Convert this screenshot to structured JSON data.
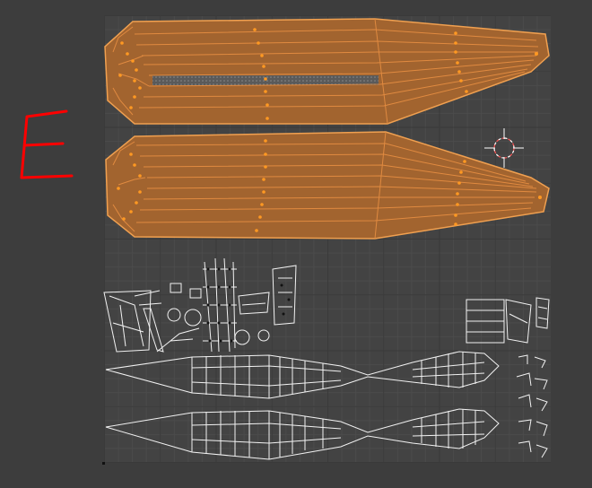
{
  "editor": {
    "type": "uv-image-editor",
    "annotation_letter": "E",
    "colors": {
      "background": "#3d3d3d",
      "grid": "#434343",
      "face_fill": "#a2642f",
      "edge_selected": "#f0a050",
      "vertex_selected": "#ff9922",
      "wire": "#f2f2f2",
      "annotation": "#ff0000"
    }
  },
  "icons": {
    "cursor": "2d-cursor-icon"
  }
}
